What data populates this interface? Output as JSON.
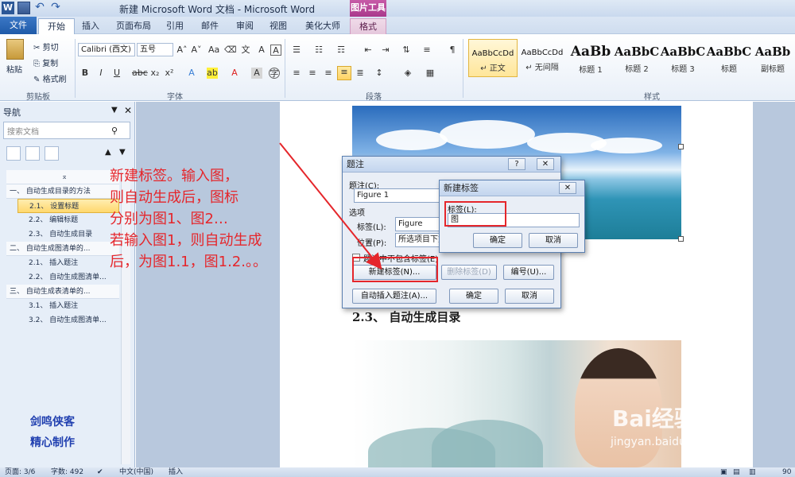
{
  "titlebar": {
    "title": "新建 Microsoft Word 文档 - Microsoft Word",
    "context_tab": "图片工具",
    "logo": "W"
  },
  "tabs": [
    "文件",
    "开始",
    "插入",
    "页面布局",
    "引用",
    "邮件",
    "审阅",
    "视图",
    "美化大师",
    "格式"
  ],
  "ribbon": {
    "clipboard": {
      "paste": "粘贴",
      "cut": "剪切",
      "copy": "复制",
      "format_painter": "格式刷",
      "label": "剪贴板"
    },
    "font": {
      "name": "Calibri (西文)",
      "size": "五号",
      "label": "字体"
    },
    "paragraph": {
      "label": "段落"
    },
    "styles": {
      "label": "样式",
      "items": [
        {
          "sample": "AaBbCcDd",
          "name": "↵ 正文"
        },
        {
          "sample": "AaBbCcDd",
          "name": "↵ 无间隔"
        },
        {
          "sample": "AaBb",
          "name": "标题 1"
        },
        {
          "sample": "AaBbC",
          "name": "标题 2"
        },
        {
          "sample": "AaBbC",
          "name": "标题 3"
        },
        {
          "sample": "AaBbC",
          "name": "标题"
        },
        {
          "sample": "AaBb",
          "name": "副标题"
        }
      ]
    }
  },
  "nav": {
    "title": "导航",
    "search_placeholder": "搜索文档",
    "items": [
      {
        "text": "一、 自动生成目录的方法",
        "level": 1
      },
      {
        "text": "2.1、 设置标题",
        "level": 2,
        "highlight": true
      },
      {
        "text": "2.2、 编辑标题",
        "level": 2
      },
      {
        "text": "2.3、 自动生成目录",
        "level": 2
      },
      {
        "text": "二、 自动生成图清单的...",
        "level": 1
      },
      {
        "text": "2.1、 插入题注",
        "level": 2
      },
      {
        "text": "2.2、 自动生成图清单...",
        "level": 2
      },
      {
        "text": "三、 自动生成表清单的...",
        "level": 1
      },
      {
        "text": "3.1、 插入题注",
        "level": 2
      },
      {
        "text": "3.2、 自动生成图清单...",
        "level": 2
      }
    ],
    "signature": [
      "剑鸣侠客",
      "精心制作"
    ]
  },
  "document": {
    "heading": "2.3、 自动生成目录"
  },
  "caption_dialog": {
    "title": "题注",
    "caption_label": "题注(C):",
    "caption_value": "Figure 1",
    "options_label": "选项",
    "label_label": "标签(L):",
    "label_value": "Figure",
    "position_label": "位置(P):",
    "position_value": "所选项目下方",
    "exclude_label": "题注中不包含标签(E)",
    "new_label_btn": "新建标签(N)...",
    "delete_label_btn": "删除标签(D)",
    "numbering_btn": "编号(U)...",
    "auto_caption_btn": "自动插入题注(A)...",
    "ok": "确定",
    "cancel": "取消"
  },
  "new_label_dialog": {
    "title": "新建标签",
    "label_label": "标签(L):",
    "label_value": "图",
    "ok": "确定",
    "cancel": "取消"
  },
  "annotation": {
    "lines": [
      "新建标签。输入图，",
      "则自动生成后，图标",
      "分别为图1、图2…",
      "若输入图1，则自动生成",
      "后，为图1.1，图1.2.。。"
    ],
    "color": "#e5262b"
  },
  "statusbar": {
    "page": "页面: 3/6",
    "words": "字数: 492",
    "language": "中文(中国)",
    "mode": "插入",
    "zoom": "90"
  },
  "watermark": {
    "main": "Bai经验",
    "sub": "jingyan.baidu.com"
  },
  "colors": {
    "accent": "#2b5797",
    "file_tab": "#1f5aa8",
    "context": "#a9388b",
    "highlight": "#ffd86e"
  }
}
